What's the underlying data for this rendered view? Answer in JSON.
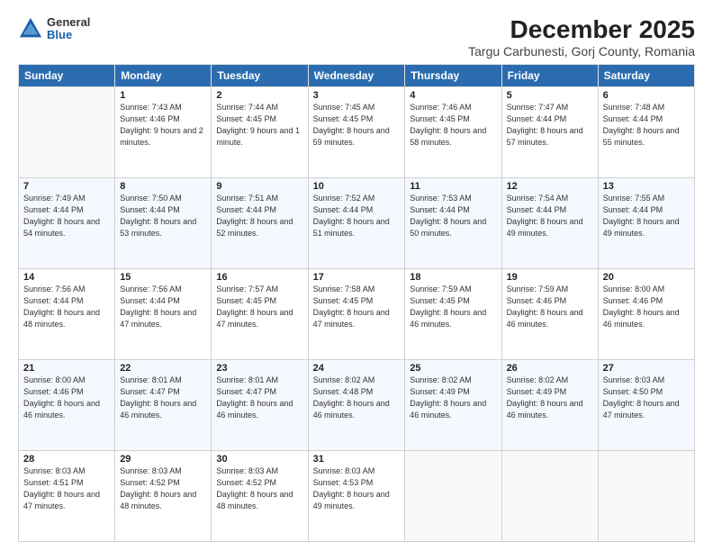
{
  "header": {
    "logo_general": "General",
    "logo_blue": "Blue",
    "title": "December 2025",
    "subtitle": "Targu Carbunesti, Gorj County, Romania"
  },
  "calendar": {
    "days": [
      "Sunday",
      "Monday",
      "Tuesday",
      "Wednesday",
      "Thursday",
      "Friday",
      "Saturday"
    ],
    "rows": [
      [
        {
          "day": "",
          "empty": true
        },
        {
          "day": "1",
          "sunrise": "Sunrise: 7:43 AM",
          "sunset": "Sunset: 4:46 PM",
          "daylight": "Daylight: 9 hours and 2 minutes."
        },
        {
          "day": "2",
          "sunrise": "Sunrise: 7:44 AM",
          "sunset": "Sunset: 4:45 PM",
          "daylight": "Daylight: 9 hours and 1 minute."
        },
        {
          "day": "3",
          "sunrise": "Sunrise: 7:45 AM",
          "sunset": "Sunset: 4:45 PM",
          "daylight": "Daylight: 8 hours and 59 minutes."
        },
        {
          "day": "4",
          "sunrise": "Sunrise: 7:46 AM",
          "sunset": "Sunset: 4:45 PM",
          "daylight": "Daylight: 8 hours and 58 minutes."
        },
        {
          "day": "5",
          "sunrise": "Sunrise: 7:47 AM",
          "sunset": "Sunset: 4:44 PM",
          "daylight": "Daylight: 8 hours and 57 minutes."
        },
        {
          "day": "6",
          "sunrise": "Sunrise: 7:48 AM",
          "sunset": "Sunset: 4:44 PM",
          "daylight": "Daylight: 8 hours and 55 minutes."
        }
      ],
      [
        {
          "day": "7",
          "sunrise": "Sunrise: 7:49 AM",
          "sunset": "Sunset: 4:44 PM",
          "daylight": "Daylight: 8 hours and 54 minutes."
        },
        {
          "day": "8",
          "sunrise": "Sunrise: 7:50 AM",
          "sunset": "Sunset: 4:44 PM",
          "daylight": "Daylight: 8 hours and 53 minutes."
        },
        {
          "day": "9",
          "sunrise": "Sunrise: 7:51 AM",
          "sunset": "Sunset: 4:44 PM",
          "daylight": "Daylight: 8 hours and 52 minutes."
        },
        {
          "day": "10",
          "sunrise": "Sunrise: 7:52 AM",
          "sunset": "Sunset: 4:44 PM",
          "daylight": "Daylight: 8 hours and 51 minutes."
        },
        {
          "day": "11",
          "sunrise": "Sunrise: 7:53 AM",
          "sunset": "Sunset: 4:44 PM",
          "daylight": "Daylight: 8 hours and 50 minutes."
        },
        {
          "day": "12",
          "sunrise": "Sunrise: 7:54 AM",
          "sunset": "Sunset: 4:44 PM",
          "daylight": "Daylight: 8 hours and 49 minutes."
        },
        {
          "day": "13",
          "sunrise": "Sunrise: 7:55 AM",
          "sunset": "Sunset: 4:44 PM",
          "daylight": "Daylight: 8 hours and 49 minutes."
        }
      ],
      [
        {
          "day": "14",
          "sunrise": "Sunrise: 7:56 AM",
          "sunset": "Sunset: 4:44 PM",
          "daylight": "Daylight: 8 hours and 48 minutes."
        },
        {
          "day": "15",
          "sunrise": "Sunrise: 7:56 AM",
          "sunset": "Sunset: 4:44 PM",
          "daylight": "Daylight: 8 hours and 47 minutes."
        },
        {
          "day": "16",
          "sunrise": "Sunrise: 7:57 AM",
          "sunset": "Sunset: 4:45 PM",
          "daylight": "Daylight: 8 hours and 47 minutes."
        },
        {
          "day": "17",
          "sunrise": "Sunrise: 7:58 AM",
          "sunset": "Sunset: 4:45 PM",
          "daylight": "Daylight: 8 hours and 47 minutes."
        },
        {
          "day": "18",
          "sunrise": "Sunrise: 7:59 AM",
          "sunset": "Sunset: 4:45 PM",
          "daylight": "Daylight: 8 hours and 46 minutes."
        },
        {
          "day": "19",
          "sunrise": "Sunrise: 7:59 AM",
          "sunset": "Sunset: 4:46 PM",
          "daylight": "Daylight: 8 hours and 46 minutes."
        },
        {
          "day": "20",
          "sunrise": "Sunrise: 8:00 AM",
          "sunset": "Sunset: 4:46 PM",
          "daylight": "Daylight: 8 hours and 46 minutes."
        }
      ],
      [
        {
          "day": "21",
          "sunrise": "Sunrise: 8:00 AM",
          "sunset": "Sunset: 4:46 PM",
          "daylight": "Daylight: 8 hours and 46 minutes."
        },
        {
          "day": "22",
          "sunrise": "Sunrise: 8:01 AM",
          "sunset": "Sunset: 4:47 PM",
          "daylight": "Daylight: 8 hours and 46 minutes."
        },
        {
          "day": "23",
          "sunrise": "Sunrise: 8:01 AM",
          "sunset": "Sunset: 4:47 PM",
          "daylight": "Daylight: 8 hours and 46 minutes."
        },
        {
          "day": "24",
          "sunrise": "Sunrise: 8:02 AM",
          "sunset": "Sunset: 4:48 PM",
          "daylight": "Daylight: 8 hours and 46 minutes."
        },
        {
          "day": "25",
          "sunrise": "Sunrise: 8:02 AM",
          "sunset": "Sunset: 4:49 PM",
          "daylight": "Daylight: 8 hours and 46 minutes."
        },
        {
          "day": "26",
          "sunrise": "Sunrise: 8:02 AM",
          "sunset": "Sunset: 4:49 PM",
          "daylight": "Daylight: 8 hours and 46 minutes."
        },
        {
          "day": "27",
          "sunrise": "Sunrise: 8:03 AM",
          "sunset": "Sunset: 4:50 PM",
          "daylight": "Daylight: 8 hours and 47 minutes."
        }
      ],
      [
        {
          "day": "28",
          "sunrise": "Sunrise: 8:03 AM",
          "sunset": "Sunset: 4:51 PM",
          "daylight": "Daylight: 8 hours and 47 minutes."
        },
        {
          "day": "29",
          "sunrise": "Sunrise: 8:03 AM",
          "sunset": "Sunset: 4:52 PM",
          "daylight": "Daylight: 8 hours and 48 minutes."
        },
        {
          "day": "30",
          "sunrise": "Sunrise: 8:03 AM",
          "sunset": "Sunset: 4:52 PM",
          "daylight": "Daylight: 8 hours and 48 minutes."
        },
        {
          "day": "31",
          "sunrise": "Sunrise: 8:03 AM",
          "sunset": "Sunset: 4:53 PM",
          "daylight": "Daylight: 8 hours and 49 minutes."
        },
        {
          "day": "",
          "empty": true
        },
        {
          "day": "",
          "empty": true
        },
        {
          "day": "",
          "empty": true
        }
      ]
    ]
  }
}
